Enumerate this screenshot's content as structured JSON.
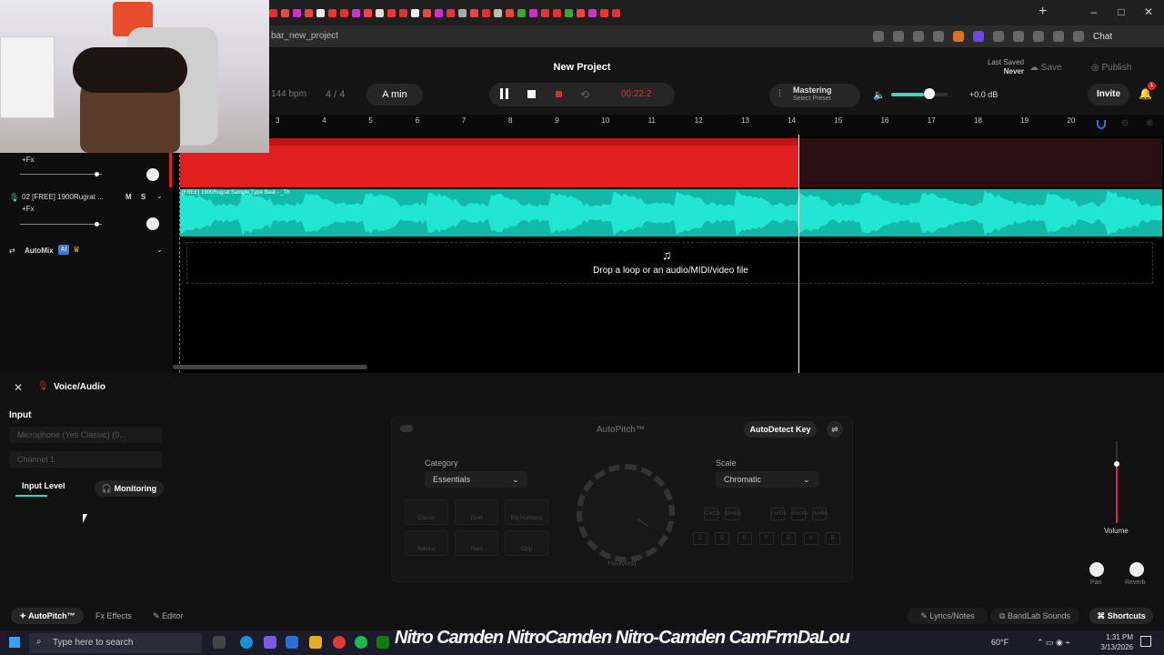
{
  "browser": {
    "url": "bar_new_project",
    "chat_label": "Chat"
  },
  "header": {
    "project_title": "New Project",
    "last_saved_label": "Last Saved",
    "last_saved_value": "Never",
    "save_label": "Save",
    "publish_label": "Publish",
    "bpm_value": "144",
    "bpm_unit": "bpm",
    "time_signature": "4 / 4",
    "key": "A min",
    "time": "00:22.2",
    "mastering_label": "Mastering",
    "mastering_preset": "Select Preset",
    "master_volume_fraction": 0.58,
    "db": "+0.0 dB",
    "invite_label": "Invite",
    "notification_count": "1"
  },
  "ruler": [
    "3",
    "4",
    "5",
    "6",
    "7",
    "8",
    "9",
    "10",
    "11",
    "12",
    "13",
    "14",
    "15",
    "16",
    "17",
    "18",
    "19",
    "20"
  ],
  "tracks": {
    "fx_label": "+Fx",
    "track2_name": "02  [FREE] 1900Rugrat ...",
    "track2_m": "M",
    "track2_s": "S",
    "automix_label": "AutoMix",
    "ai_badge": "AI",
    "clip2_label": "[FREE] 1900Rugrat Sample Type Beat - _Th"
  },
  "dropzone": {
    "text": "Drop a loop or an audio/MIDI/video file"
  },
  "panel": {
    "title": "Voice/Audio",
    "input_label": "Input",
    "input_device": "Microphone (Yeti Classic) (0...",
    "channel": "Channel 1",
    "input_level_label": "Input Level",
    "monitoring_label": "Monitoring",
    "autopitch_title": "AutoPitch™",
    "autodetect_label": "AutoDetect Key",
    "category_label": "Category",
    "category_value": "Essentials",
    "scale_label": "Scale",
    "scale_value": "Chromatic",
    "presets": [
      "Classic",
      "Duet",
      "Big Harmony",
      "Natural",
      "Hard",
      "Chip"
    ],
    "dial_label": "Heaviest",
    "keys_top": [
      "C#/Db",
      "D#/Eb",
      "F#/Gb",
      "G#/Ab",
      "A#/Bb"
    ],
    "keys_bottom": [
      "C",
      "D",
      "E",
      "F",
      "G",
      "A",
      "B"
    ],
    "volume_label": "Volume",
    "pan_label": "Pan",
    "reverb_label": "Reverb"
  },
  "bottom_tabs": {
    "autopitch": "AutoPitch™",
    "effects": "Effects",
    "editor": "Editor",
    "lyrics": "Lyrics/Notes",
    "bandlab": "BandLab Sounds",
    "shortcuts": "Shortcuts"
  },
  "taskbar": {
    "search_placeholder": "Type here to search",
    "stream_text": "Nitro Camden  NitroCamden  Nitro-Camden  CamFrmDaLou",
    "weather": "60°F",
    "time": "1:31 PM",
    "date": "3/13/2026"
  },
  "colors": {
    "accent": "#3fd8b6",
    "track1_clip": "#e11f1f",
    "track2_clip": "#12b8a8",
    "record": "#e02a2a"
  }
}
